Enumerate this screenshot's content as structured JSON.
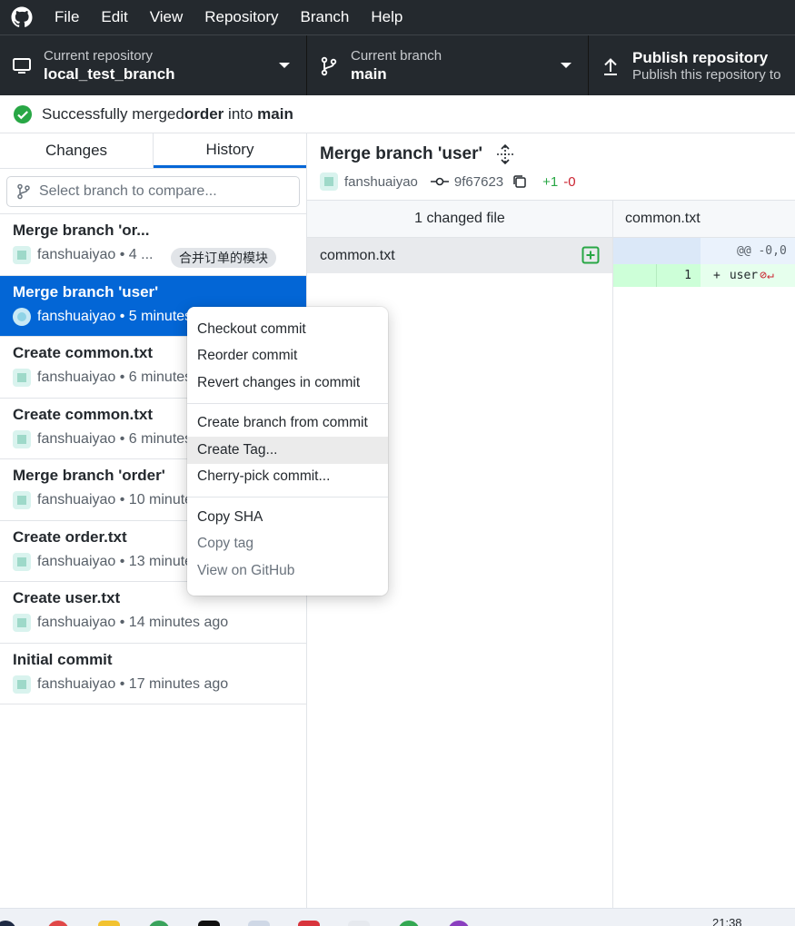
{
  "menubar": {
    "items": [
      "File",
      "Edit",
      "View",
      "Repository",
      "Branch",
      "Help"
    ]
  },
  "toolbar": {
    "repo_label": "Current repository",
    "repo_name": "local_test_branch",
    "branch_label": "Current branch",
    "branch_name": "main",
    "publish_title": "Publish repository",
    "publish_desc": "Publish this repository to"
  },
  "banner": {
    "prefix": "Successfully merged ",
    "source": "order",
    "middle": " into ",
    "target": "main"
  },
  "tabs": {
    "changes": "Changes",
    "history": "History"
  },
  "compare": {
    "placeholder": "Select branch to compare..."
  },
  "commits": [
    {
      "title": "Merge branch 'or...",
      "author": "fanshuaiyao",
      "time": " • 4 ...",
      "tag": "合并订单的模块"
    },
    {
      "title": "Merge branch 'user'",
      "author": "fanshuaiyao",
      "time": " • 5 minutes ago"
    },
    {
      "title": "Create common.txt",
      "author": "fanshuaiyao",
      "time": " • 6 minutes ago"
    },
    {
      "title": "Create common.txt",
      "author": "fanshuaiyao",
      "time": " • 6 minutes ago"
    },
    {
      "title": "Merge branch 'order'",
      "author": "fanshuaiyao",
      "time": " • 10 minutes ago"
    },
    {
      "title": "Create order.txt",
      "author": "fanshuaiyao",
      "time": " • 13 minutes ago"
    },
    {
      "title": "Create user.txt",
      "author": "fanshuaiyao",
      "time": " • 14 minutes ago"
    },
    {
      "title": "Initial commit",
      "author": "fanshuaiyao",
      "time": " • 17 minutes ago"
    }
  ],
  "detail": {
    "title": "Merge branch 'user'",
    "author": "fanshuaiyao",
    "sha": "9f67623",
    "additions": "+1",
    "deletions": "-0",
    "changed_files_label": "1 changed file",
    "files": [
      "common.txt"
    ],
    "diff_file": "common.txt",
    "hunk_header": "@@ -0,0",
    "line_number": "1",
    "line_marker": "+",
    "line_text": "user"
  },
  "context_menu": {
    "items": [
      "Checkout commit",
      "Reorder commit",
      "Revert changes in commit",
      "Create branch from commit",
      "Create Tag...",
      "Cherry-pick commit...",
      "Copy SHA",
      "Copy tag",
      "View on GitHub"
    ]
  },
  "taskbar": {
    "clock": "21:38"
  },
  "colors": {
    "accent": "#0366d6",
    "dark_chrome": "#24292e",
    "success": "#28a745",
    "danger": "#cb2431"
  },
  "icons": {
    "menubar": "github-mark-icon",
    "repo": "desktop-computer-icon",
    "branch": "git-branch-icon",
    "publish": "upload-arrow-icon",
    "banner": "check-circle-icon",
    "sha": "git-commit-icon",
    "copy": "copy-icon",
    "file_added": "plus-square-icon"
  }
}
